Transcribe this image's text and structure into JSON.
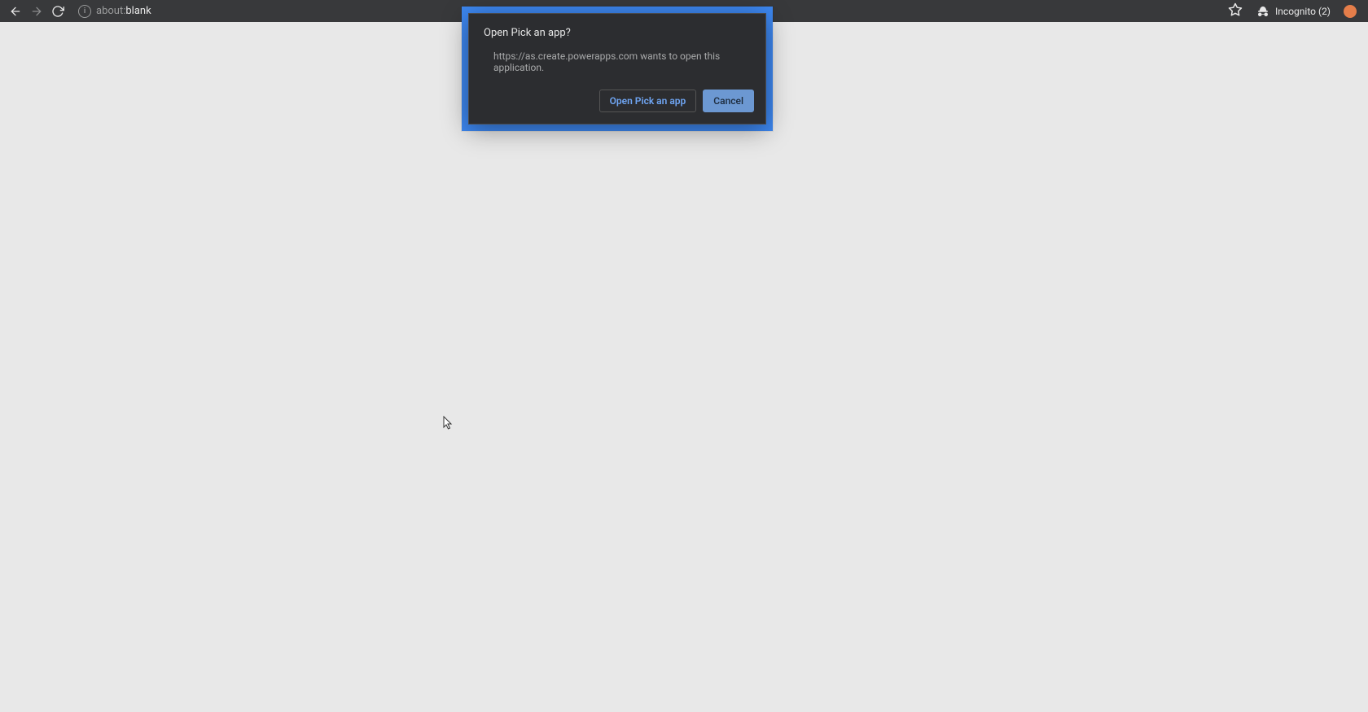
{
  "toolbar": {
    "url_prefix": "about:",
    "url_suffix": "blank",
    "incognito_label": "Incognito (2)"
  },
  "dialog": {
    "title": "Open Pick an app?",
    "message": "https://as.create.powerapps.com wants to open this application.",
    "open_label": "Open Pick an app",
    "cancel_label": "Cancel"
  }
}
